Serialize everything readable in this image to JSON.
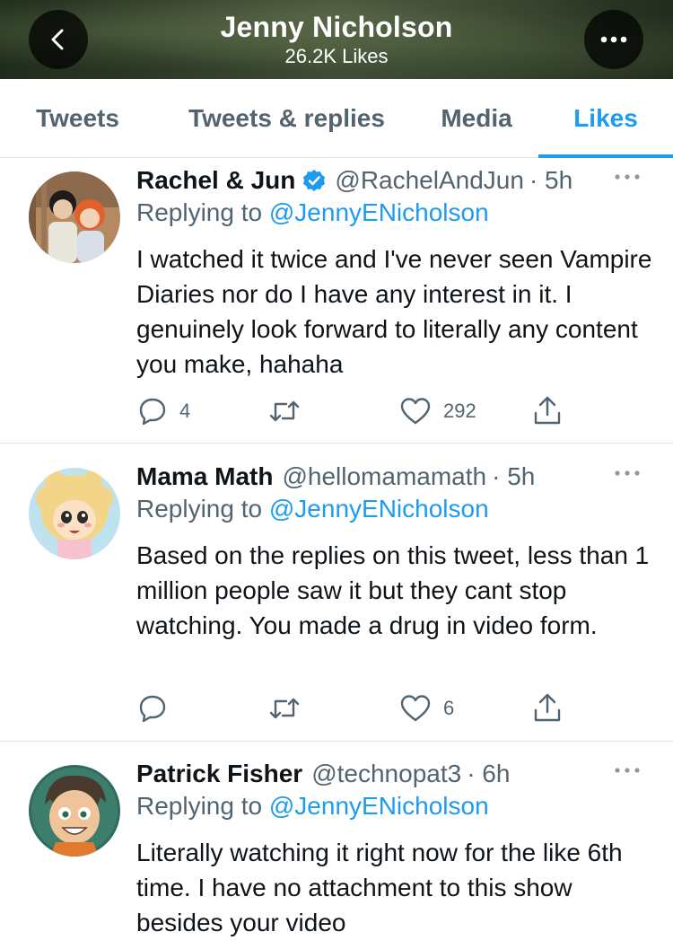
{
  "header": {
    "title": "Jenny Nicholson",
    "subtitle": "26.2K Likes",
    "back_icon": "chevron-left-icon",
    "more_icon": "more-horizontal-icon"
  },
  "tabs": [
    {
      "label": "Tweets",
      "active": false
    },
    {
      "label": "Tweets & replies",
      "active": false
    },
    {
      "label": "Media",
      "active": false
    },
    {
      "label": "Likes",
      "active": true
    }
  ],
  "colors": {
    "accent": "#1d9bf0",
    "secondary_text": "#536471",
    "primary_text": "#0f1419",
    "divider": "#dfe3e6"
  },
  "tweets": [
    {
      "name": "Rachel & Jun",
      "verified": true,
      "handle": "@RachelAndJun",
      "time": "· 5h",
      "replying_prefix": "Replying to ",
      "replying_to": "@JennyENicholson",
      "text": "I watched it twice and I've never seen Vampire Diaries nor do I have any interest in it. I genuinely look forward to literally any content you make, hahaha",
      "reply_count": "4",
      "retweet_count": "",
      "like_count": "292"
    },
    {
      "name": "Mama Math",
      "verified": false,
      "handle": "@hellomamamath",
      "time": "· 5h",
      "replying_prefix": "Replying to ",
      "replying_to": "@JennyENicholson",
      "text": "Based on the replies on this tweet, less than 1 million people saw it but they cant stop watching. You made a drug in video form.",
      "reply_count": "",
      "retweet_count": "",
      "like_count": "6"
    },
    {
      "name": "Patrick Fisher",
      "verified": false,
      "handle": "@technopat3",
      "time": "· 6h",
      "replying_prefix": "Replying to ",
      "replying_to": "@JennyENicholson",
      "text": "Literally watching it right now for the like 6th time. I have no attachment to this show besides your video"
    }
  ]
}
